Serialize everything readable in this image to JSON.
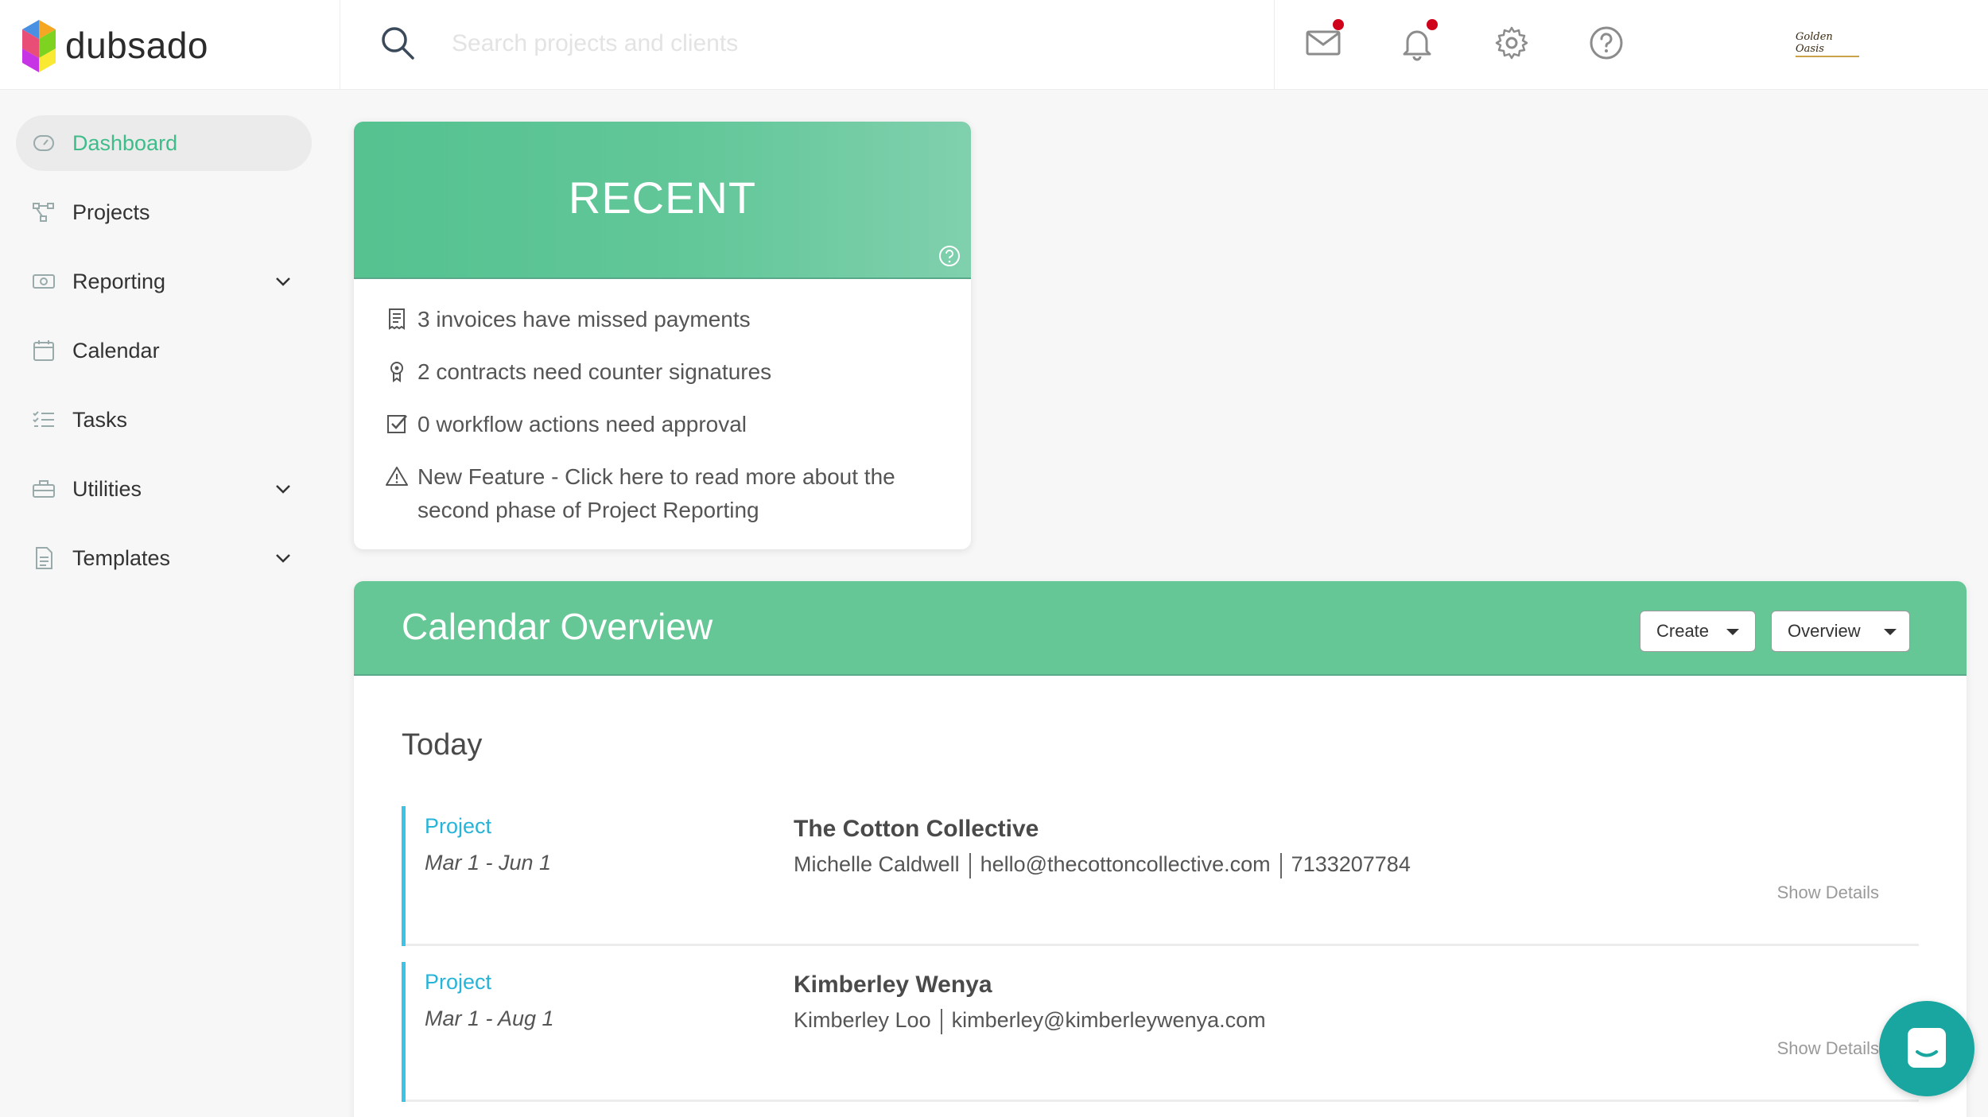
{
  "brand": {
    "name": "dubsado"
  },
  "search": {
    "placeholder": "Search projects and clients"
  },
  "header": {
    "icons": [
      "mail-icon",
      "bell-icon",
      "gear-icon",
      "help-icon"
    ],
    "notification_color": "#d0021b",
    "account_logo_text": "Golden Oasis"
  },
  "sidebar": {
    "items": [
      {
        "label": "Dashboard",
        "icon": "dashboard-icon",
        "active": true
      },
      {
        "label": "Projects",
        "icon": "projects-icon"
      },
      {
        "label": "Reporting",
        "icon": "reporting-icon",
        "expandable": true
      },
      {
        "label": "Calendar",
        "icon": "calendar-icon"
      },
      {
        "label": "Tasks",
        "icon": "tasks-icon"
      },
      {
        "label": "Utilities",
        "icon": "utilities-icon",
        "expandable": true
      },
      {
        "label": "Templates",
        "icon": "templates-icon",
        "expandable": true
      }
    ],
    "active_color": "#3ebd8b"
  },
  "recent": {
    "title": "RECENT",
    "items": [
      {
        "icon": "invoice-icon",
        "text": "3 invoices have missed payments"
      },
      {
        "icon": "contract-icon",
        "text": "2 contracts need counter signatures"
      },
      {
        "icon": "checkbox-icon",
        "text": "0 workflow actions need approval"
      },
      {
        "icon": "warning-icon",
        "text": "New Feature - Click here to read more about the second phase of Project Reporting"
      }
    ]
  },
  "calendar": {
    "title": "Calendar Overview",
    "create_label": "Create",
    "overview_label": "Overview",
    "today_label": "Today",
    "events": [
      {
        "type": "Project",
        "date": "Mar 1 - Jun 1",
        "name": "The Cotton Collective",
        "contact_name": "Michelle Caldwell",
        "email": "hello@thecottoncollective.com",
        "phone": "7133207784",
        "details_label": "Show Details"
      },
      {
        "type": "Project",
        "date": "Mar 1 - Aug 1",
        "name": "Kimberley Wenya",
        "contact_name": "Kimberley Loo",
        "email": "kimberley@kimberleywenya.com",
        "details_label": "Show Details"
      }
    ],
    "header_color": "#66c796",
    "event_accent": "#3cc4e6"
  },
  "chat": {
    "icon": "chat-icon"
  }
}
